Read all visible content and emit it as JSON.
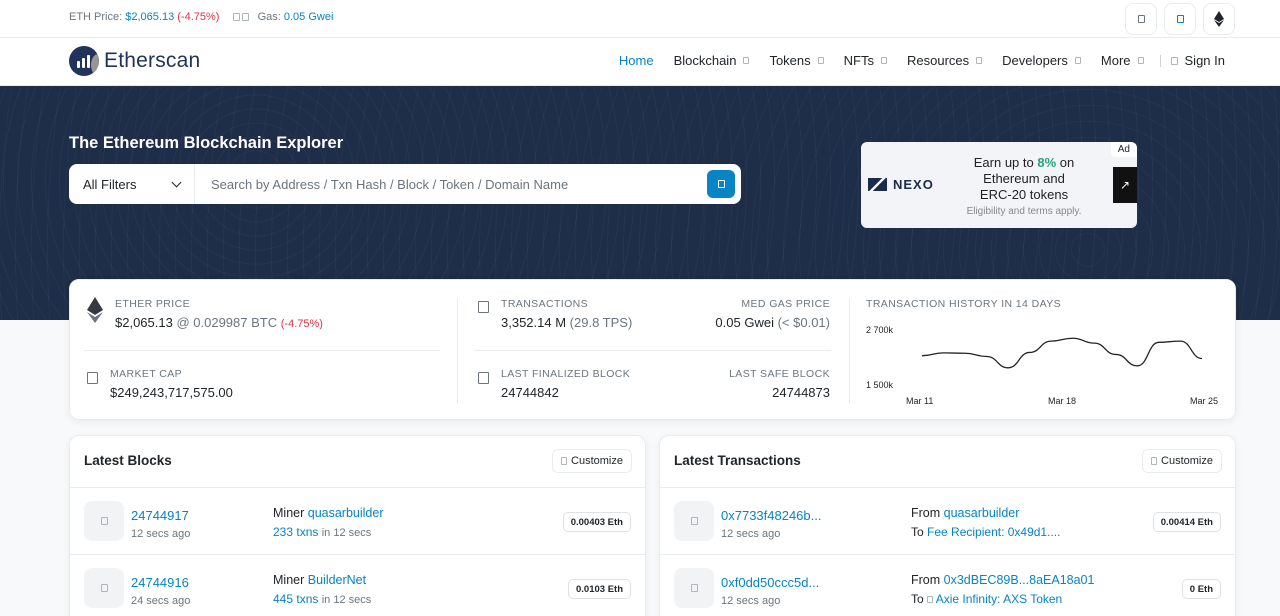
{
  "topbar": {
    "eth_price_label": "ETH Price:",
    "eth_price": "$2,065.13",
    "eth_change": "(-4.75%)",
    "gas_label": "Gas:",
    "gas_value": "0.05 Gwei"
  },
  "header": {
    "logo_text": "Etherscan",
    "nav": {
      "home": "Home",
      "blockchain": "Blockchain",
      "tokens": "Tokens",
      "nfts": "NFTs",
      "resources": "Resources",
      "developers": "Developers",
      "more": "More",
      "sign_in": "Sign In"
    }
  },
  "hero": {
    "title": "The Ethereum Blockchain Explorer",
    "filter_label": "All Filters",
    "search_placeholder": "Search by Address / Txn Hash / Block / Token / Domain Name"
  },
  "ad": {
    "tag": "Ad",
    "brand": "NEXO",
    "line1_pre": "Earn up to ",
    "line1_highlight": "8%",
    "line1_post": " on",
    "line2": "Ethereum and",
    "line3": "ERC-20 tokens",
    "sub": "Eligibility and terms apply.",
    "arrow": "↗"
  },
  "stats": {
    "ether_price_label": "ETHER PRICE",
    "ether_price_usd": "$2,065.13",
    "ether_price_btc": "@ 0.029987 BTC",
    "ether_price_change": "(-4.75%)",
    "market_cap_label": "MARKET CAP",
    "market_cap_value": "$249,243,717,575.00",
    "transactions_label": "TRANSACTIONS",
    "transactions_value": "3,352.14 M",
    "transactions_tps": "(29.8 TPS)",
    "gas_label": "MED GAS PRICE",
    "gas_value": "0.05 Gwei",
    "gas_usd": "(< $0.01)",
    "finalized_label": "LAST FINALIZED BLOCK",
    "finalized_value": "24744842",
    "safe_label": "LAST SAFE BLOCK",
    "safe_value": "24744873"
  },
  "chart_data": {
    "type": "line",
    "title": "TRANSACTION HISTORY IN 14 DAYS",
    "x": [
      "Mar 11",
      "Mar 12",
      "Mar 13",
      "Mar 14",
      "Mar 15",
      "Mar 16",
      "Mar 17",
      "Mar 18",
      "Mar 19",
      "Mar 20",
      "Mar 21",
      "Mar 22",
      "Mar 23",
      "Mar 24",
      "Mar 25"
    ],
    "y": [
      2150000,
      2220000,
      2210000,
      2130000,
      1850000,
      2230000,
      2510000,
      2580000,
      2460000,
      2180000,
      1900000,
      2480000,
      2510000,
      2080000
    ],
    "x_labels": [
      "Mar 11",
      "Mar 18",
      "Mar 25"
    ],
    "y_ticks": [
      "2 700k",
      "1 500k"
    ],
    "ylim": [
      1500000,
      2700000
    ],
    "color": "#212529"
  },
  "latest_blocks": {
    "title": "Latest Blocks",
    "customize": "Customize",
    "rows": [
      {
        "block": "24744917",
        "age": "12 secs ago",
        "miner_label": "Miner",
        "miner": "quasarbuilder",
        "txns": "233 txns",
        "time": "in 12 secs",
        "reward": "0.00403 Eth"
      },
      {
        "block": "24744916",
        "age": "24 secs ago",
        "miner_label": "Miner",
        "miner": "BuilderNet",
        "txns": "445 txns",
        "time": "in 12 secs",
        "reward": "0.0103 Eth"
      }
    ]
  },
  "latest_txns": {
    "title": "Latest Transactions",
    "customize": "Customize",
    "rows": [
      {
        "hash": "0x7733f48246b...",
        "age": "12 secs ago",
        "from_label": "From",
        "from": "quasarbuilder",
        "to_label": "To",
        "to": "Fee Recipient: 0x49d1....",
        "amount": "0.00414 Eth"
      },
      {
        "hash": "0xf0dd50ccc5d...",
        "age": "12 secs ago",
        "from_label": "From",
        "from": "0x3dBEC89B...8aEA18a01",
        "to_label": "To",
        "to": "Axie Infinity: AXS Token",
        "amount": "0 Eth"
      }
    ]
  }
}
